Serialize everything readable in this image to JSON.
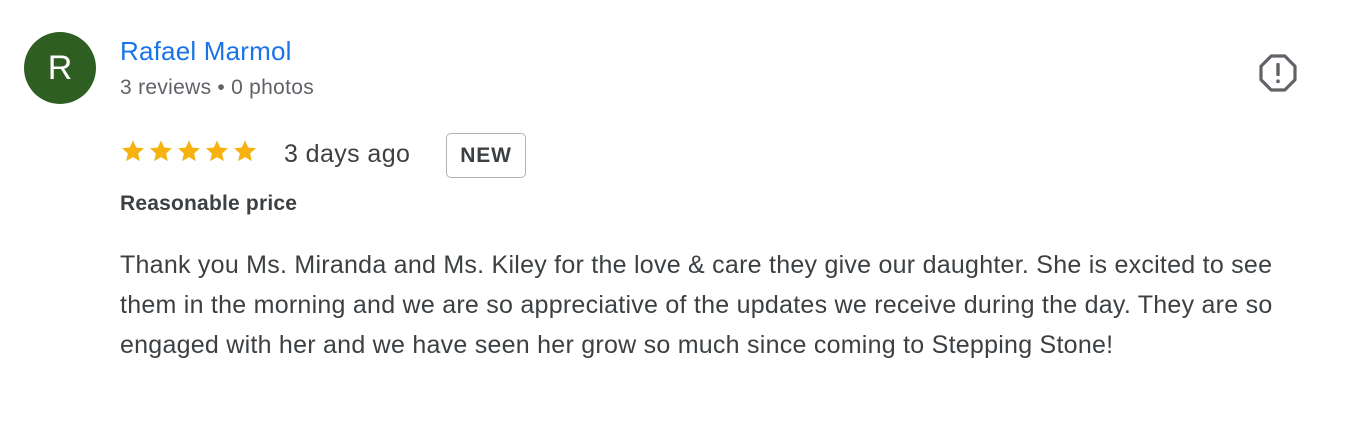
{
  "reviewer": {
    "avatar_letter": "R",
    "avatar_color": "#2e5e22",
    "name": "Rafael Marmol",
    "reviews_count": "3 reviews",
    "separator": "•",
    "photos_count": "0 photos"
  },
  "review": {
    "rating": 5,
    "rating_max": 5,
    "star_color": "#f6b20f",
    "date": "3 days ago",
    "badge": "NEW",
    "attribute": "Reasonable price",
    "text": "Thank you Ms. Miranda and Ms. Kiley for the love & care they give our daughter. She is excited to see them in the morning and we are so appreciative of the updates we receive during the day. They are so engaged with her and we have seen her grow so much since coming to Stepping Stone!"
  },
  "icons": {
    "report": "report-flag-icon",
    "star": "star-icon"
  },
  "colors": {
    "name_link": "#1a73e8",
    "secondary_text": "#5f6368",
    "body_text": "#3c4043"
  }
}
